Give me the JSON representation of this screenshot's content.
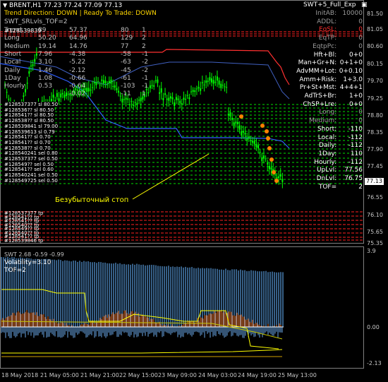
{
  "header": {
    "symbol": "BRENT,H1",
    "ohlc": "77.23 77.24 77.09 77.13",
    "indicator_name": "SWT+5_Full_Exp",
    "trend_label": "Trend Direction:",
    "trend_value": "DOWN",
    "ready_label": "Ready To Trade:",
    "ready_value": "DOWN",
    "separator": "|",
    "sub_title": "SWT_SRLvls_TOF=2",
    "order_overlap": "#128539839"
  },
  "stats": [
    {
      "name": "Trend",
      "c1": "89",
      "c2": "57.37",
      "c3": "80",
      "c4": "1"
    },
    {
      "name": "Long",
      "c1": "50.20",
      "c2": "64.96",
      "c3": "129",
      "c4": "2"
    },
    {
      "name": "Medium",
      "c1": "19.14",
      "c2": "14.76",
      "c3": "77",
      "c4": "2"
    },
    {
      "name": "Short",
      "c1": "7.96",
      "c2": "-4.38",
      "c3": "-58",
      "c4": "-1"
    },
    {
      "name": "Local",
      "c1": "3.10",
      "c2": "-5.22",
      "c3": "-63",
      "c4": "-2"
    },
    {
      "name": "Daily",
      "c1": "1.46",
      "c2": "-2.12",
      "c3": "-45",
      "c4": "-2"
    },
    {
      "name": "1Day",
      "c1": "1.08",
      "c2": "-0.66",
      "c3": "-61",
      "c4": "-1"
    },
    {
      "name": "Hourly",
      "c1": "0.53",
      "c2": "-0.64",
      "c3": "-103",
      "c4": "-1"
    },
    {
      "name": "",
      "c1": "",
      "c2": "-0.02",
      "c3": "-11",
      "c4": "1"
    }
  ],
  "info_panel": [
    {
      "label": "InitAB:",
      "value": "10000",
      "color": "#9a9a9a"
    },
    {
      "label": "ADDL:",
      "value": "0",
      "color": "#9a9a9a"
    },
    {
      "label": "EqSL:",
      "value": "0",
      "color": "#ff3030"
    },
    {
      "label": "EqTP:",
      "value": "0",
      "color": "#9a9a9a"
    },
    {
      "label": "EqtpPc:",
      "value": "0",
      "color": "#9a9a9a"
    },
    {
      "label": "Hft+Bl:",
      "value": "0+0",
      "color": "#ffffff"
    },
    {
      "label": "Man+Gr+N:",
      "value": "0+1+0",
      "color": "#ffffff"
    },
    {
      "label": "AdvMM+Lot:",
      "value": "0+0.10",
      "color": "#ffffff"
    },
    {
      "label": "Amm+Risk:",
      "value": "1+3.0",
      "color": "#ffffff"
    },
    {
      "label": "Pr+St+Mst:",
      "value": "4+4+1",
      "color": "#ffffff"
    },
    {
      "label": "AdTrS+Br:",
      "value": "1+0",
      "color": "#ffffff"
    },
    {
      "label": "ChSP+Lre:",
      "value": "0+0",
      "color": "#ffffff"
    },
    {
      "label": "Long:",
      "value": "0",
      "color": "#9a9a9a"
    },
    {
      "label": "Medium:",
      "value": "0",
      "color": "#9a9a9a"
    },
    {
      "label": "Short:",
      "value": "-110",
      "color": "#ffffff"
    },
    {
      "label": "Local:",
      "value": "-112",
      "color": "#ffffff"
    },
    {
      "label": "Daily:",
      "value": "-112",
      "color": "#ffffff"
    },
    {
      "label": "1Day:",
      "value": "110",
      "color": "#ffffff"
    },
    {
      "label": "Hourly:",
      "value": "-112",
      "color": "#ffffff"
    },
    {
      "label": "UpLvl:",
      "value": "77.56",
      "color": "#ffffff"
    },
    {
      "label": "DnLvl:",
      "value": "76.75",
      "color": "#ffffff"
    },
    {
      "label": "TOF=",
      "value": "2",
      "color": "#ffffff"
    }
  ],
  "order_labels_upper": [
    "#128537377 sl 80.50",
    "#128536?? sl 80.50",
    "#128541?? sl 80.50",
    "#128538?? sl 80.50",
    "#128539841 sl 79.00",
    "#128539613 sl 0.79",
    "#128541?? sl 0.70",
    "#128541?? sl 0.70",
    "#128538?? sl 0.70",
    "#128540241 sel 0.80",
    "#128537377 sel 0.50",
    "#128549?? sel 0.50",
    "#128541?? sel 0.60",
    "#128540241 sel 0.50",
    "#128549725 sel 0.50"
  ],
  "order_labels_lower": [
    "#128537377 tp",
    "#128541?? tp",
    "#128541?? tp",
    "#128540?? tp",
    "#128549?? tp",
    "#128540?? tp",
    "#128541?? tp",
    "#128539846 tp"
  ],
  "annotation": "Безубыточный стоп",
  "price_axis": {
    "ticks": [
      "81.50",
      "81.05",
      "80.60",
      "80.15",
      "79.70",
      "79.25",
      "78.80",
      "78.35",
      "77.90",
      "77.45",
      "77.13",
      "76.55",
      "76.10",
      "75.65",
      "75.35"
    ],
    "current_price": "77.13"
  },
  "sub_window": {
    "title": "SWT 2.68 -0.59 -0.99",
    "volatility": "Volatility=3.10",
    "tof": "TOF=2",
    "ticks": [
      "3.9",
      "0.00",
      "-2.13"
    ]
  },
  "time_axis": [
    "18 May 2018",
    "21 May 05:00",
    "21 May 21:00",
    "22 May 15:00",
    "23 May 09:00",
    "24 May 03:00",
    "24 May 19:00",
    "25 May 13:00"
  ],
  "colors": {
    "candle": "#00ff00",
    "up_line": "#ff3030",
    "down_line": "#3060ff",
    "order_red": "#ff2020",
    "order_green": "#00e000",
    "arrow": "#ff8000",
    "annotation": "#ffff00",
    "hist_blue": "#5a9ee0",
    "hist_orange": "#e06010"
  }
}
